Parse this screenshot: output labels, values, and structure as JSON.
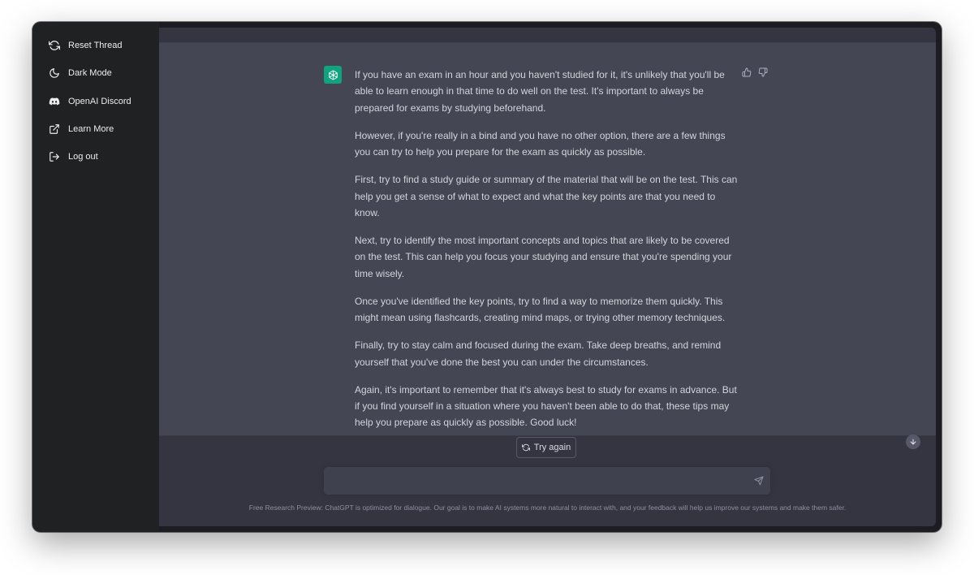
{
  "sidebar": {
    "items": [
      {
        "label": "Reset Thread",
        "icon": "refresh-icon"
      },
      {
        "label": "Dark Mode",
        "icon": "moon-icon"
      },
      {
        "label": "OpenAI Discord",
        "icon": "discord-icon"
      },
      {
        "label": "Learn More",
        "icon": "external-link-icon"
      },
      {
        "label": "Log out",
        "icon": "logout-icon"
      }
    ]
  },
  "response": {
    "avatar_icon": "openai-logo-icon",
    "paragraphs": [
      "If you have an exam in an hour and you haven't studied for it, it's unlikely that you'll be able to learn enough in that time to do well on the test. It's important to always be prepared for exams by studying beforehand.",
      "However, if you're really in a bind and you have no other option, there are a few things you can try to help you prepare for the exam as quickly as possible.",
      "First, try to find a study guide or summary of the material that will be on the test. This can help you get a sense of what to expect and what the key points are that you need to know.",
      "Next, try to identify the most important concepts and topics that are likely to be covered on the test. This can help you focus your studying and ensure that you're spending your time wisely.",
      "Once you've identified the key points, try to find a way to memorize them quickly. This might mean using flashcards, creating mind maps, or trying other memory techniques.",
      "Finally, try to stay calm and focused during the exam. Take deep breaths, and remind yourself that you've done the best you can under the circumstances.",
      "Again, it's important to remember that it's always best to study for exams in advance. But if you find yourself in a situation where you haven't been able to do that, these tips may help you prepare as quickly as possible. Good luck!"
    ]
  },
  "controls": {
    "try_again_label": "Try again",
    "input_value": "",
    "input_placeholder": ""
  },
  "footer": {
    "text": "Free Research Preview: ChatGPT is optimized for dialogue. Our goal is to make AI systems more natural to interact with, and your feedback will help us improve our systems and make them safer."
  },
  "colors": {
    "sidebar_bg": "#202123",
    "main_bg": "#343541",
    "answer_bg": "#444654",
    "accent": "#10a37f"
  }
}
